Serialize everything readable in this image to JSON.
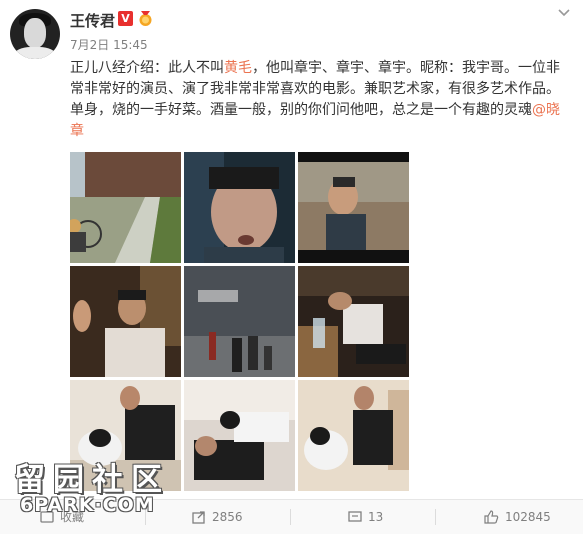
{
  "post": {
    "author": "王传君",
    "verified_badge": "V",
    "time": "7月2日 15:45",
    "text_part1": "正儿八经介绍：此人不叫",
    "text_highlight": "黄毛",
    "text_part2": "，他叫章宇、章宇、章宇。昵称：我宇哥。一位非常非常好的演员、演了我非常非常喜欢的电影。兼职艺术家，有很多艺术作品。单身，烧的一手好菜。酒量一般，别的你们问他吧，总之是一个有趣的灵魂",
    "mention": "@晓章",
    "photos_count": 9
  },
  "actions": {
    "favorite_label": "收藏",
    "repost_count": "2856",
    "comment_count": "13",
    "like_count": "102845"
  },
  "watermark": {
    "chinese": "留园社区",
    "english": "6PARK·COM"
  },
  "colors": {
    "highlight": "#eb7350",
    "verified": "#e8302e",
    "meta_text": "#808080"
  },
  "icons": [
    "chevron-down-icon",
    "medal-icon",
    "favorite-icon",
    "repost-icon",
    "comment-icon",
    "like-icon"
  ]
}
